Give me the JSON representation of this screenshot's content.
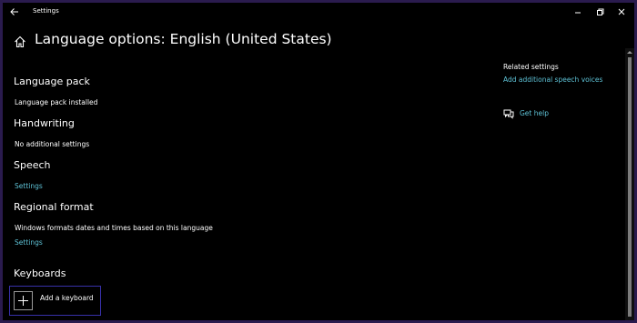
{
  "window": {
    "title": "Settings"
  },
  "page": {
    "title": "Language options: English (United States)"
  },
  "sections": {
    "language_pack": {
      "heading": "Language pack",
      "status": "Language pack installed"
    },
    "handwriting": {
      "heading": "Handwriting",
      "status": "No additional settings"
    },
    "speech": {
      "heading": "Speech",
      "link": "Settings"
    },
    "regional_format": {
      "heading": "Regional format",
      "description": "Windows formats dates and times based on this language",
      "link": "Settings"
    },
    "keyboards": {
      "heading": "Keyboards",
      "add_label": "Add a keyboard"
    }
  },
  "related": {
    "title": "Related settings",
    "link": "Add additional speech voices",
    "help": "Get help"
  },
  "icons": {
    "back": "back-arrow-icon",
    "home": "home-icon",
    "minimize": "minimize-icon",
    "maximize": "restore-icon",
    "close": "close-icon",
    "help": "chat-help-icon",
    "add": "plus-icon"
  },
  "colors": {
    "background": "#000000",
    "text": "#ffffff",
    "link": "#5ec2d6",
    "accent_border": "#3730a8",
    "frame": "#2a1b4e"
  }
}
